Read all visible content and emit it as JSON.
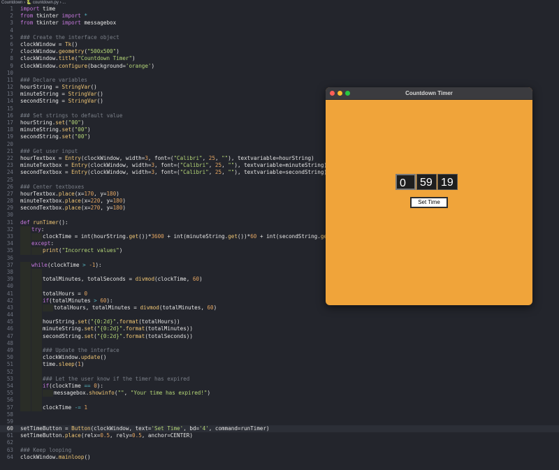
{
  "breadcrumb": {
    "folder": "Countdown",
    "file": "countdown.py",
    "tail": "..."
  },
  "colors": {
    "window_bg": "#f0a43a",
    "editor_bg": "#23252c"
  },
  "window": {
    "title": "Countdown Timer",
    "hour_value": "0",
    "minute_value": "59",
    "second_value": "19",
    "set_time_label": "Set Time"
  },
  "editor": {
    "active_line": 60,
    "lines": [
      [
        [
          "k",
          "import"
        ],
        [
          "v",
          " time"
        ]
      ],
      [
        [
          "k",
          "from"
        ],
        [
          "v",
          " tkinter "
        ],
        [
          "k",
          "import"
        ],
        [
          "v",
          " "
        ],
        [
          "o",
          "*"
        ]
      ],
      [
        [
          "k",
          "from"
        ],
        [
          "v",
          " tkinter "
        ],
        [
          "k",
          "import"
        ],
        [
          "v",
          " messagebox"
        ]
      ],
      [],
      [
        [
          "c",
          "### Create the interface object"
        ]
      ],
      [
        [
          "v",
          "clockWindow = "
        ],
        [
          "f",
          "Tk"
        ],
        [
          "v",
          "()"
        ]
      ],
      [
        [
          "v",
          "clockWindow."
        ],
        [
          "f",
          "geometry"
        ],
        [
          "v",
          "("
        ],
        [
          "s",
          "\"500x500\""
        ],
        [
          "v",
          ")"
        ]
      ],
      [
        [
          "v",
          "clockWindow."
        ],
        [
          "f",
          "title"
        ],
        [
          "v",
          "("
        ],
        [
          "s",
          "\"Countdown Timer\""
        ],
        [
          "v",
          ")"
        ]
      ],
      [
        [
          "v",
          "clockWindow."
        ],
        [
          "f",
          "configure"
        ],
        [
          "v",
          "(background="
        ],
        [
          "s",
          "'orange'"
        ],
        [
          "v",
          ")"
        ]
      ],
      [],
      [
        [
          "c",
          "### Declare variables"
        ]
      ],
      [
        [
          "v",
          "hourString = "
        ],
        [
          "f",
          "StringVar"
        ],
        [
          "v",
          "()"
        ]
      ],
      [
        [
          "v",
          "minuteString = "
        ],
        [
          "f",
          "StringVar"
        ],
        [
          "v",
          "()"
        ]
      ],
      [
        [
          "v",
          "secondString = "
        ],
        [
          "f",
          "StringVar"
        ],
        [
          "v",
          "()"
        ]
      ],
      [],
      [
        [
          "c",
          "### Set strings to default value"
        ]
      ],
      [
        [
          "v",
          "hourString."
        ],
        [
          "f",
          "set"
        ],
        [
          "v",
          "("
        ],
        [
          "s",
          "\"00\""
        ],
        [
          "v",
          ")"
        ]
      ],
      [
        [
          "v",
          "minuteString."
        ],
        [
          "f",
          "set"
        ],
        [
          "v",
          "("
        ],
        [
          "s",
          "\"00\""
        ],
        [
          "v",
          ")"
        ]
      ],
      [
        [
          "v",
          "secondString."
        ],
        [
          "f",
          "set"
        ],
        [
          "v",
          "("
        ],
        [
          "s",
          "\"00\""
        ],
        [
          "v",
          ")"
        ]
      ],
      [],
      [
        [
          "c",
          "### Get user input"
        ]
      ],
      [
        [
          "v",
          "hourTextbox = "
        ],
        [
          "f",
          "Entry"
        ],
        [
          "v",
          "(clockWindow, width="
        ],
        [
          "n",
          "3"
        ],
        [
          "v",
          ", font=("
        ],
        [
          "s",
          "\"Calibri\""
        ],
        [
          "v",
          ", "
        ],
        [
          "n",
          "25"
        ],
        [
          "v",
          ", "
        ],
        [
          "s",
          "\"\""
        ],
        [
          "v",
          "), textvariable=hourString)"
        ]
      ],
      [
        [
          "v",
          "minuteTextbox = "
        ],
        [
          "f",
          "Entry"
        ],
        [
          "v",
          "(clockWindow, width="
        ],
        [
          "n",
          "3"
        ],
        [
          "v",
          ", font=("
        ],
        [
          "s",
          "\"Calibri\""
        ],
        [
          "v",
          ", "
        ],
        [
          "n",
          "25"
        ],
        [
          "v",
          ", "
        ],
        [
          "s",
          "\"\""
        ],
        [
          "v",
          "), textvariable=minuteString)"
        ]
      ],
      [
        [
          "v",
          "secondTextbox = "
        ],
        [
          "f",
          "Entry"
        ],
        [
          "v",
          "(clockWindow, width="
        ],
        [
          "n",
          "3"
        ],
        [
          "v",
          ", font=("
        ],
        [
          "s",
          "\"Calibri\""
        ],
        [
          "v",
          ", "
        ],
        [
          "n",
          "25"
        ],
        [
          "v",
          ", "
        ],
        [
          "s",
          "\"\""
        ],
        [
          "v",
          "), textvariable=secondString)"
        ]
      ],
      [],
      [
        [
          "c",
          "### Center textboxes"
        ]
      ],
      [
        [
          "v",
          "hourTextbox."
        ],
        [
          "f",
          "place"
        ],
        [
          "v",
          "(x="
        ],
        [
          "n",
          "170"
        ],
        [
          "v",
          ", y="
        ],
        [
          "n",
          "180"
        ],
        [
          "v",
          ")"
        ]
      ],
      [
        [
          "v",
          "minuteTextbox."
        ],
        [
          "f",
          "place"
        ],
        [
          "v",
          "(x="
        ],
        [
          "n",
          "220"
        ],
        [
          "v",
          ", y="
        ],
        [
          "n",
          "180"
        ],
        [
          "v",
          ")"
        ]
      ],
      [
        [
          "v",
          "secondTextbox."
        ],
        [
          "f",
          "place"
        ],
        [
          "v",
          "(x="
        ],
        [
          "n",
          "270"
        ],
        [
          "v",
          ", y="
        ],
        [
          "n",
          "180"
        ],
        [
          "v",
          ")"
        ]
      ],
      [],
      [
        [
          "k",
          "def"
        ],
        [
          "v",
          " "
        ],
        [
          "f",
          "runTimer"
        ],
        [
          "v",
          "():"
        ]
      ],
      [
        [
          "i",
          1
        ],
        [
          "k",
          "try"
        ],
        [
          "v",
          ":"
        ]
      ],
      [
        [
          "i",
          2
        ],
        [
          "v",
          "clockTime = int(hourString."
        ],
        [
          "f",
          "get"
        ],
        [
          "v",
          "())*"
        ],
        [
          "n",
          "3600"
        ],
        [
          "v",
          " + int(minuteString."
        ],
        [
          "f",
          "get"
        ],
        [
          "v",
          "())*"
        ],
        [
          "n",
          "60"
        ],
        [
          "v",
          " + int(secondString."
        ],
        [
          "f",
          "get"
        ],
        [
          "v",
          "())"
        ]
      ],
      [
        [
          "i",
          1
        ],
        [
          "k",
          "except"
        ],
        [
          "v",
          ":"
        ]
      ],
      [
        [
          "i",
          2
        ],
        [
          "f",
          "print"
        ],
        [
          "v",
          "("
        ],
        [
          "s",
          "\"Incorrect values\""
        ],
        [
          "v",
          ")"
        ]
      ],
      [],
      [
        [
          "i",
          1
        ],
        [
          "k",
          "while"
        ],
        [
          "v",
          "(clockTime "
        ],
        [
          "o",
          ">"
        ],
        [
          "v",
          " "
        ],
        [
          "n",
          "-1"
        ],
        [
          "v",
          "):"
        ]
      ],
      [
        [
          "i",
          2
        ]
      ],
      [
        [
          "i",
          2
        ],
        [
          "v",
          "totalMinutes, totalSeconds = "
        ],
        [
          "f",
          "divmod"
        ],
        [
          "v",
          "(clockTime, "
        ],
        [
          "n",
          "60"
        ],
        [
          "v",
          ")"
        ]
      ],
      [
        [
          "i",
          2
        ]
      ],
      [
        [
          "i",
          2
        ],
        [
          "v",
          "totalHours = "
        ],
        [
          "n",
          "0"
        ]
      ],
      [
        [
          "i",
          2
        ],
        [
          "k",
          "if"
        ],
        [
          "v",
          "(totalMinutes "
        ],
        [
          "o",
          ">"
        ],
        [
          "v",
          " "
        ],
        [
          "n",
          "60"
        ],
        [
          "v",
          "):"
        ]
      ],
      [
        [
          "i",
          3
        ],
        [
          "v",
          "totalHours, totalMinutes = "
        ],
        [
          "f",
          "divmod"
        ],
        [
          "v",
          "(totalMinutes, "
        ],
        [
          "n",
          "60"
        ],
        [
          "v",
          ")"
        ]
      ],
      [
        [
          "i",
          2
        ]
      ],
      [
        [
          "i",
          2
        ],
        [
          "v",
          "hourString."
        ],
        [
          "f",
          "set"
        ],
        [
          "v",
          "("
        ],
        [
          "s",
          "\"{0:2d}\""
        ],
        [
          "v",
          "."
        ],
        [
          "f",
          "format"
        ],
        [
          "v",
          "(totalHours))"
        ]
      ],
      [
        [
          "i",
          2
        ],
        [
          "v",
          "minuteString."
        ],
        [
          "f",
          "set"
        ],
        [
          "v",
          "("
        ],
        [
          "s",
          "\"{0:2d}\""
        ],
        [
          "v",
          "."
        ],
        [
          "f",
          "format"
        ],
        [
          "v",
          "(totalMinutes))"
        ]
      ],
      [
        [
          "i",
          2
        ],
        [
          "v",
          "secondString."
        ],
        [
          "f",
          "set"
        ],
        [
          "v",
          "("
        ],
        [
          "s",
          "\"{0:2d}\""
        ],
        [
          "v",
          "."
        ],
        [
          "f",
          "format"
        ],
        [
          "v",
          "(totalSeconds))"
        ]
      ],
      [
        [
          "i",
          2
        ]
      ],
      [
        [
          "i",
          2
        ],
        [
          "c",
          "### Update the interface"
        ]
      ],
      [
        [
          "i",
          2
        ],
        [
          "v",
          "clockWindow."
        ],
        [
          "f",
          "update"
        ],
        [
          "v",
          "()"
        ]
      ],
      [
        [
          "i",
          2
        ],
        [
          "v",
          "time."
        ],
        [
          "f",
          "sleep"
        ],
        [
          "v",
          "("
        ],
        [
          "n",
          "1"
        ],
        [
          "v",
          ")"
        ]
      ],
      [
        [
          "i",
          2
        ]
      ],
      [
        [
          "i",
          2
        ],
        [
          "c",
          "### Let the user know if the timer has expired"
        ]
      ],
      [
        [
          "i",
          2
        ],
        [
          "k",
          "if"
        ],
        [
          "v",
          "(clockTime "
        ],
        [
          "o",
          "=="
        ],
        [
          "v",
          " "
        ],
        [
          "n",
          "0"
        ],
        [
          "v",
          "):"
        ]
      ],
      [
        [
          "i",
          3
        ],
        [
          "v",
          "messagebox."
        ],
        [
          "f",
          "showinfo"
        ],
        [
          "v",
          "("
        ],
        [
          "s",
          "\"\""
        ],
        [
          "v",
          ", "
        ],
        [
          "s",
          "\"Your time has expired!\""
        ],
        [
          "v",
          ")"
        ]
      ],
      [
        [
          "i",
          2
        ]
      ],
      [
        [
          "i",
          2
        ],
        [
          "v",
          "clockTime "
        ],
        [
          "o",
          "-="
        ],
        [
          "v",
          " "
        ],
        [
          "n",
          "1"
        ]
      ],
      [],
      [],
      [
        [
          "v",
          "setTimeButton = "
        ],
        [
          "f",
          "Button"
        ],
        [
          "v",
          "(clockWindow, text="
        ],
        [
          "s",
          "'Set Time'"
        ],
        [
          "v",
          ", bd="
        ],
        [
          "s",
          "'4'"
        ],
        [
          "v",
          ", command=runTimer)"
        ]
      ],
      [
        [
          "v",
          "setTimeButton."
        ],
        [
          "f",
          "place"
        ],
        [
          "v",
          "(relx="
        ],
        [
          "n",
          "0.5"
        ],
        [
          "v",
          ", rely="
        ],
        [
          "n",
          "0.5"
        ],
        [
          "v",
          ", anchor=CENTER)"
        ]
      ],
      [],
      [
        [
          "c",
          "### Keep looping"
        ]
      ],
      [
        [
          "v",
          "clockWindow."
        ],
        [
          "f",
          "mainloop"
        ],
        [
          "v",
          "()"
        ]
      ]
    ]
  }
}
